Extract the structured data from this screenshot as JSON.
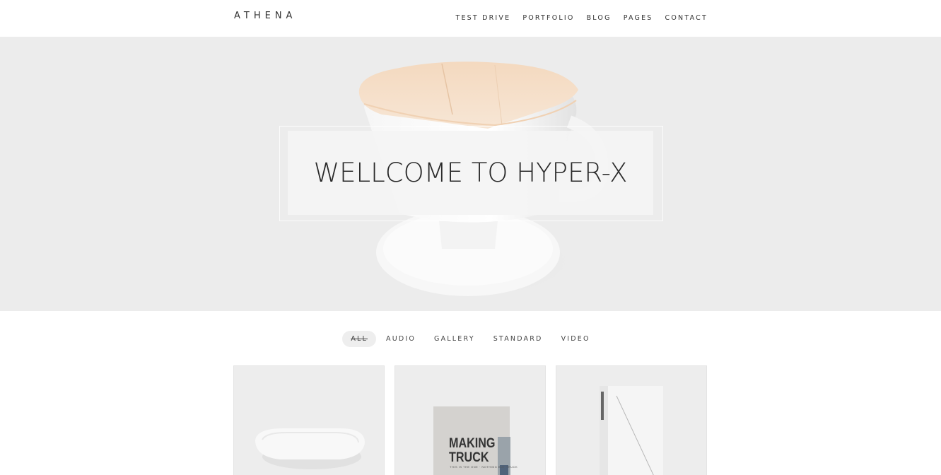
{
  "header": {
    "logo": "ATHENA",
    "nav": [
      "TEST DRIVE",
      "PORTFOLIO",
      "BLOG",
      "PAGES",
      "CONTACT"
    ]
  },
  "hero": {
    "title": "WELLCOME TO HYPER-X"
  },
  "filters": {
    "items": [
      "ALL",
      "AUDIO",
      "GALLERY",
      "STANDARD",
      "VIDEO"
    ],
    "active": "ALL"
  },
  "portfolio": {
    "items": [
      {
        "subject": "white ceramic dish"
      },
      {
        "subject": "book",
        "book_title_line1": "MAKING",
        "book_title_line2": "TRUCK",
        "book_subtitle": "THIS IS THE ONE · NOTHING BUT TRUCK"
      },
      {
        "subject": "white box with thread"
      }
    ]
  },
  "colors": {
    "hero_background": "#ececec",
    "card_background": "#ededed",
    "text": "#333333",
    "active_filter_background": "#eeeeee"
  }
}
